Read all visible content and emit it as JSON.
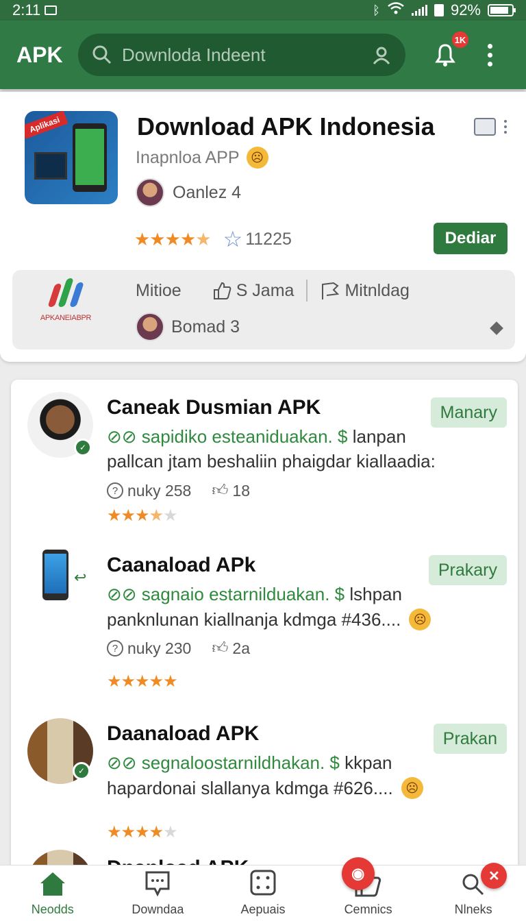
{
  "status_bar": {
    "time": "2:11",
    "battery": "92%"
  },
  "app_bar": {
    "brand": "APK",
    "search_placeholder": "Downloda Indeent",
    "notification_badge": "1K"
  },
  "featured": {
    "title": "Download APK Indonesia",
    "icon_ribbon": "Aplikasi",
    "subtitle": "Inapnloa APP",
    "author": "Oanlez 4",
    "rating_stars": 4.5,
    "review_count": "11225",
    "action_label": "Dediar",
    "developer_logo_label": "APKANEIABPR",
    "info_items": [
      "Mitioe",
      "S Jama",
      "Mitnldag"
    ],
    "info_author": "Bomad 3"
  },
  "list_items": [
    {
      "title": "Caneak Dusmian APK",
      "line1_green": "⊘⊘ sapidiko esteaniduakan. $",
      "line1_rest": "lanpan",
      "line2": "pallcan jtam beshaliin phaigdar kiallaadia:",
      "views": "nuky 258",
      "likes": "18",
      "stars": 3.5,
      "tag": "Manary"
    },
    {
      "title": "Caanaload APk",
      "line1_green": "⊘⊘ sagnaio estarnilduakan. $",
      "line1_rest": "lshpan",
      "line2": "panknlunan kiallnanja kdmga #436....",
      "views": "nuky 230",
      "likes": "2a",
      "stars": 5,
      "tag": "Prakary"
    },
    {
      "title": "Daanaload APK",
      "line1_green": "⊘⊘ segnaloostarnildhakan. $",
      "line1_rest": "kkpan",
      "line2": "hapardonai slallanya kdmga #626....",
      "views": "",
      "likes": "",
      "stars": 4,
      "tag": "Prakan"
    }
  ],
  "truncated_item": {
    "title": "Dnanload APK"
  },
  "bottom_nav": {
    "items": [
      {
        "label": "Neodds",
        "icon": "home-icon",
        "active": true
      },
      {
        "label": "Downdaa",
        "icon": "chat-icon",
        "active": false
      },
      {
        "label": "Aepuais",
        "icon": "dice-icon",
        "active": false
      },
      {
        "label": "Cemnics",
        "icon": "thumb-icon",
        "active": false
      },
      {
        "label": "Nlneks",
        "icon": "search-icon",
        "active": false
      }
    ]
  },
  "colors": {
    "primary": "#2f7a45",
    "accent": "#2f7a3e",
    "star": "#f08a24",
    "badge": "#e53935",
    "tag_bg": "#d6ebd9"
  }
}
